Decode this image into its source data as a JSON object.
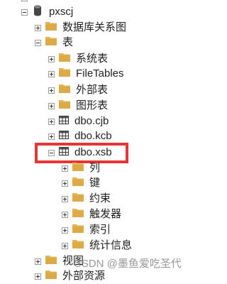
{
  "tree": {
    "root": {
      "label": "pxscj"
    },
    "items": [
      {
        "label": "数据库关系图"
      },
      {
        "label": "表"
      },
      {
        "label": "系统表"
      },
      {
        "label": "FileTables"
      },
      {
        "label": "外部表"
      },
      {
        "label": "图形表"
      },
      {
        "label": "dbo.cjb"
      },
      {
        "label": "dbo.kcb"
      },
      {
        "label": "dbo.xsb"
      },
      {
        "label": "列"
      },
      {
        "label": "键"
      },
      {
        "label": "约束"
      },
      {
        "label": "触发器"
      },
      {
        "label": "索引"
      },
      {
        "label": "统计信息"
      },
      {
        "label": "视图"
      },
      {
        "label": "外部资源"
      }
    ]
  },
  "watermark": "CSDN @墨鱼爱吃圣代",
  "colors": {
    "highlight_border": "#e53535",
    "folder": "#e3b451"
  }
}
